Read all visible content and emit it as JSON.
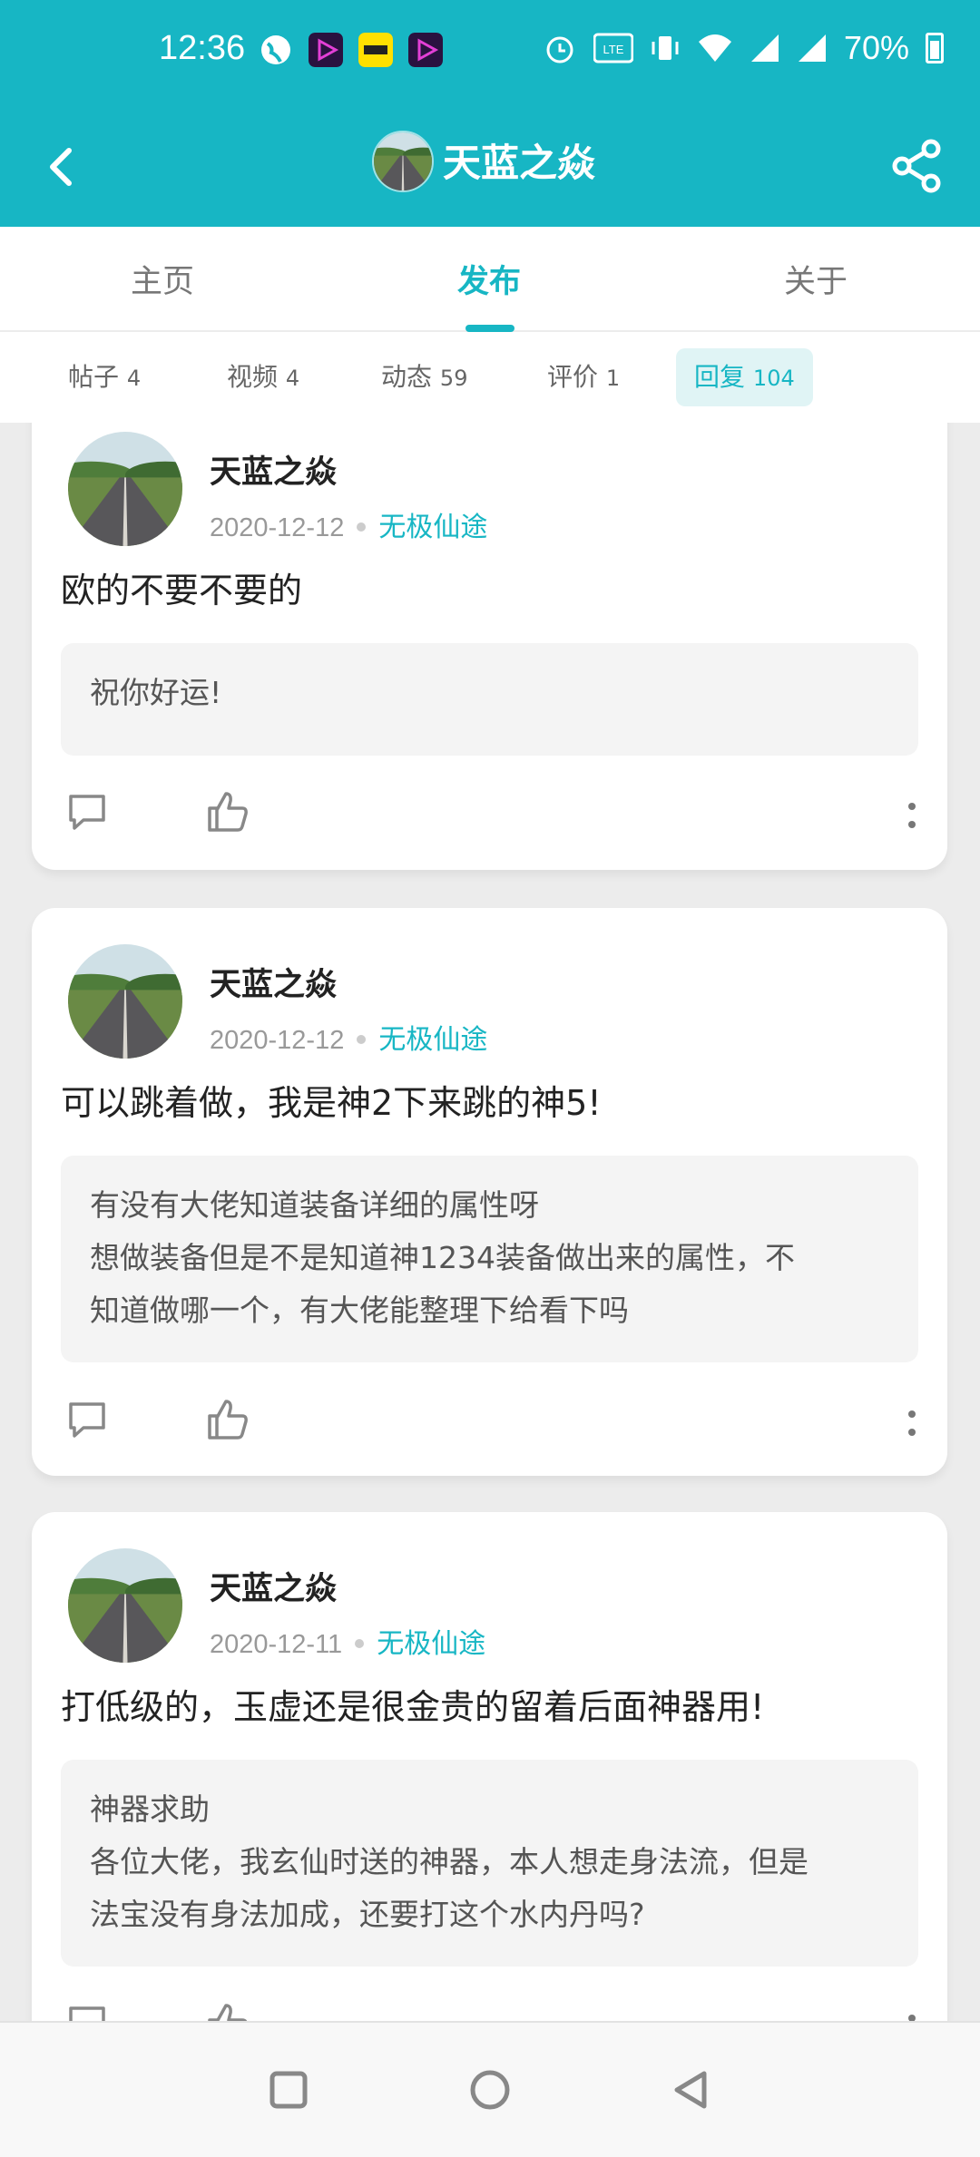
{
  "status_bar": {
    "time": "12:36",
    "battery": "70%",
    "icons": [
      "globe-icon",
      "video-app-icon",
      "yellow-app-icon",
      "video-app-icon",
      "alarm-icon",
      "volte-icon",
      "vibrate-icon",
      "wifi-icon",
      "signal-icon",
      "signal-icon",
      "battery-icon"
    ]
  },
  "header": {
    "username": "天蓝之焱",
    "back_icon": "chevron-left-icon",
    "share_icon": "share-icon",
    "bg_color": "#17b6c4"
  },
  "tabs": [
    {
      "label": "主页",
      "active": false
    },
    {
      "label": "发布",
      "active": true
    },
    {
      "label": "关于",
      "active": false
    }
  ],
  "subtabs": [
    {
      "label": "帖子",
      "count": "4"
    },
    {
      "label": "视频",
      "count": "4"
    },
    {
      "label": "动态",
      "count": "59"
    },
    {
      "label": "评价",
      "count": "1"
    },
    {
      "label": "回复",
      "count": "104",
      "active": true
    }
  ],
  "posts": [
    {
      "username": "天蓝之焱",
      "date": "2020-12-12",
      "game": "无极仙途",
      "content": "欧的不要不要的",
      "quote_lines": [
        "祝你好运!"
      ]
    },
    {
      "username": "天蓝之焱",
      "date": "2020-12-12",
      "game": "无极仙途",
      "content": "可以跳着做，我是神2下来跳的神5!",
      "quote_lines": [
        "有没有大佬知道装备详细的属性呀",
        "想做装备但是不是知道神1234装备做出来的属性，不",
        "知道做哪一个，有大佬能整理下给看下吗"
      ]
    },
    {
      "username": "天蓝之焱",
      "date": "2020-12-11",
      "game": "无极仙途",
      "content": "打低级的，玉虚还是很金贵的留着后面神器用!",
      "quote_lines": [
        "神器求助",
        "各位大佬，我玄仙时送的神器，本人想走身法流，但是",
        "法宝没有身法加成，还要打这个水内丹吗?"
      ]
    }
  ],
  "nav_bar": {
    "buttons": [
      "recents-square-icon",
      "home-circle-icon",
      "back-triangle-icon"
    ]
  }
}
